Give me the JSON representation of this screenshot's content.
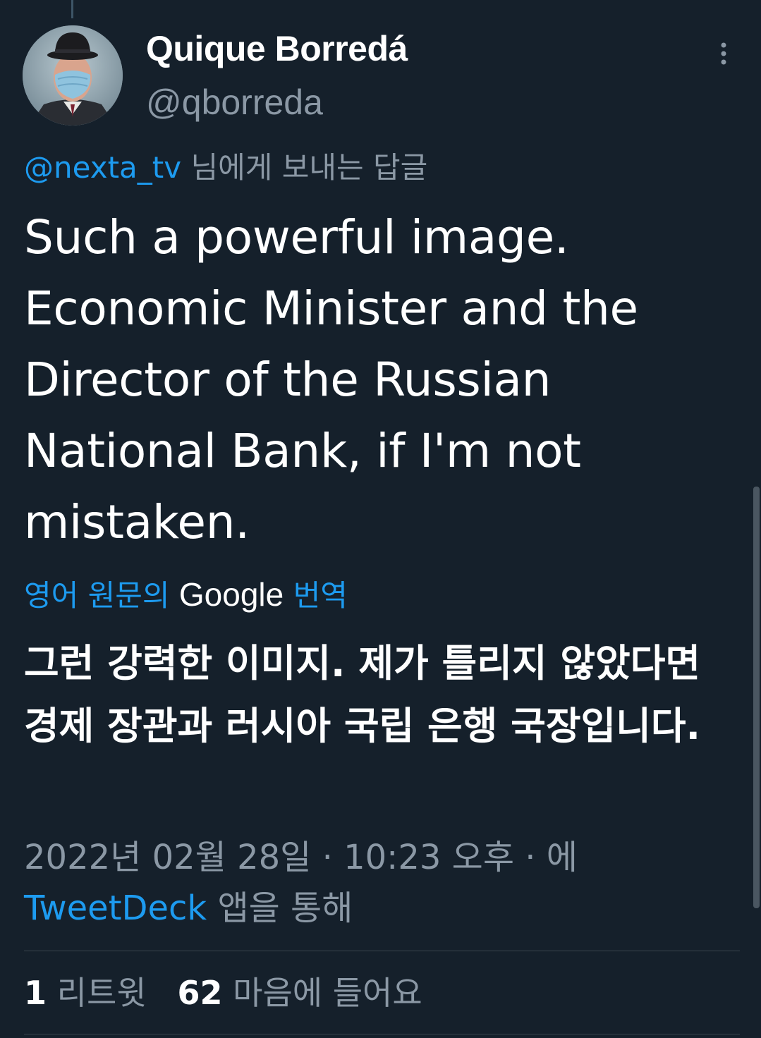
{
  "author": {
    "display_name": "Quique Borredá",
    "handle": "@qborreda",
    "avatar_icon": "avatar-bowler-hat-mask"
  },
  "reply_to": {
    "handle": "@nexta_tv",
    "suffix": " 님에게 보내는 답글"
  },
  "tweet": {
    "text": "Such a powerful image. Economic Minister and the Director of the Russian National Bank, if I'm not mistaken."
  },
  "translation": {
    "prefix": "영어 원문의 ",
    "provider": "Google",
    "action": " 번역",
    "text": "그런 강력한 이미지. 제가 틀리지 않았다면 경제 장관과 러시아 국립 은행 국장입니다."
  },
  "meta": {
    "timestamp": "2022년 02월 28일 · 10:23 오후 · 에",
    "source": "TweetDeck",
    "source_suffix": " 앱을 통해"
  },
  "stats": {
    "retweets_count": "1",
    "retweets_label": " 리트윗",
    "likes_count": "62",
    "likes_label": " 마음에 들어요"
  },
  "colors": {
    "background": "#15202b",
    "link": "#1d9bf0",
    "muted": "#8b98a5",
    "divider": "#38444d"
  },
  "icons": {
    "more": "more-vertical-icon"
  }
}
